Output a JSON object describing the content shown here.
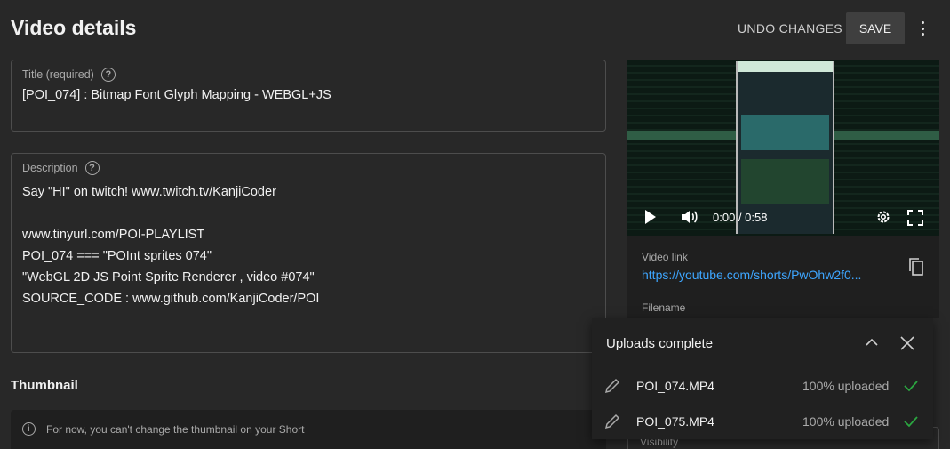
{
  "header": {
    "title": "Video details",
    "undo_label": "UNDO CHANGES",
    "save_label": "SAVE"
  },
  "title_field": {
    "label": "Title (required)",
    "value": "[POI_074] : Bitmap Font Glyph Mapping - WEBGL+JS"
  },
  "description_field": {
    "label": "Description",
    "lines": [
      "Say \"HI\" on twitch! www.twitch.tv/KanjiCoder",
      "",
      "www.tinyurl.com/POI-PLAYLIST",
      "POI_074 === \"POInt sprites 074\"",
      "\"WebGL 2D JS Point Sprite Renderer , video #074\"",
      "SOURCE_CODE : www.github.com/KanjiCoder/POI"
    ]
  },
  "thumbnail": {
    "heading": "Thumbnail",
    "note": "For now, you can't change the thumbnail on your Short"
  },
  "video": {
    "time": "0:00 / 0:58",
    "link_label": "Video link",
    "link": "https://youtube.com/shorts/PwOhw2f0...",
    "filename_label": "Filename",
    "visibility_label": "Visibility"
  },
  "uploads": {
    "title": "Uploads complete",
    "items": [
      {
        "name": "POI_074.MP4",
        "status": "100% uploaded"
      },
      {
        "name": "POI_075.MP4",
        "status": "100% uploaded"
      }
    ]
  },
  "icons": {
    "help": "help-circle-icon",
    "info": "info-icon",
    "play": "play-icon",
    "volume": "volume-icon",
    "settings": "gear-icon",
    "fullscreen": "fullscreen-icon",
    "copy": "copy-icon",
    "chevron": "chevron-up-icon",
    "close": "close-icon",
    "edit": "pencil-icon",
    "done": "check-icon"
  },
  "colors": {
    "background": "#282828",
    "link": "#3ea6ff",
    "check": "#2ba640"
  }
}
